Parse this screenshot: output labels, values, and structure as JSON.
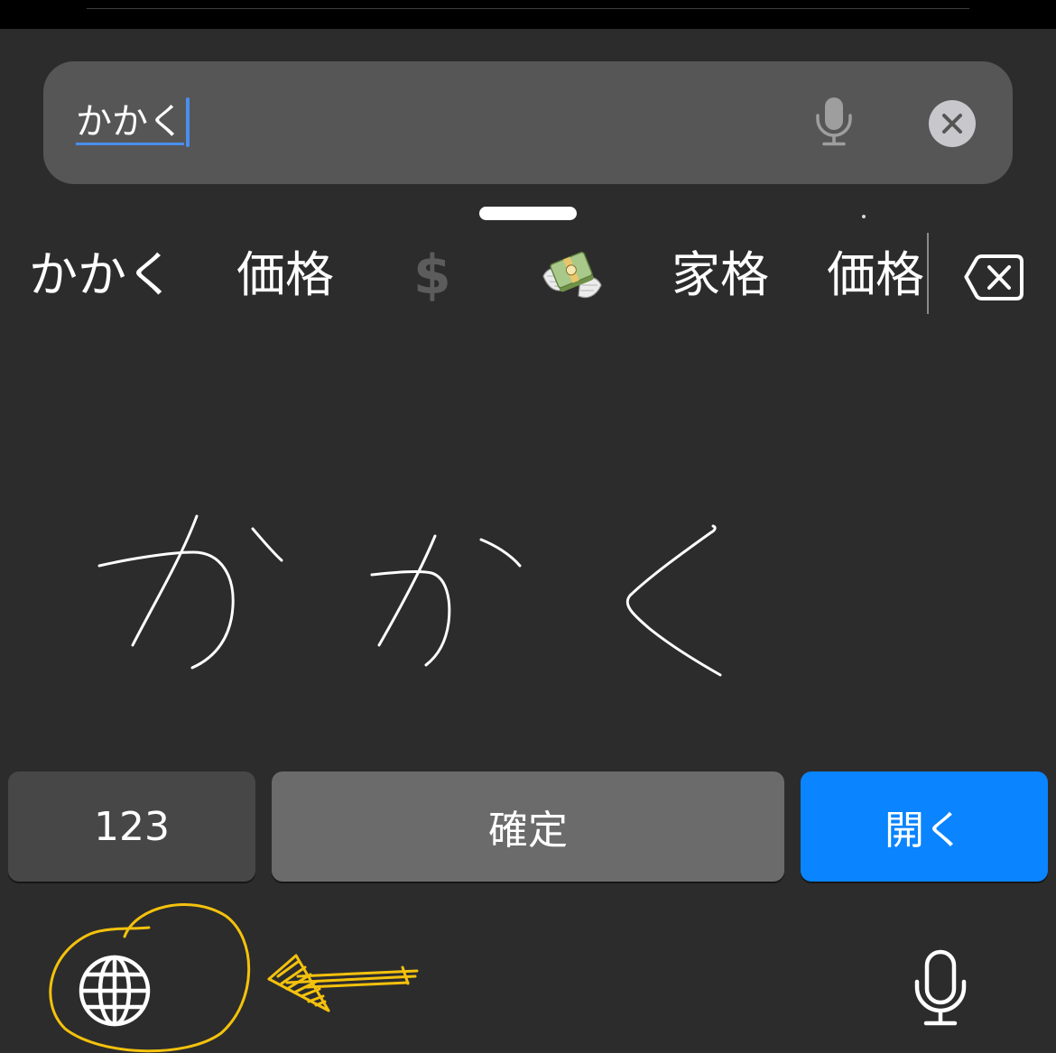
{
  "colors": {
    "background": "#2c2c2c",
    "search_field": "#565656",
    "accent": "#0a84ff",
    "cursor": "#4a8ef0",
    "annotation": "#f4c20d",
    "candidate_muted": "#5c5c5c"
  },
  "search": {
    "value": "かかく",
    "mic_icon": "microphone-icon",
    "clear_icon": "clear-icon"
  },
  "candidates": [
    {
      "text": "かかく"
    },
    {
      "text": "価格"
    },
    {
      "text": "$"
    },
    {
      "icon": "money-with-wings-icon"
    },
    {
      "text": "家格"
    },
    {
      "text": "価格"
    }
  ],
  "backspace_icon": "delete-left-icon",
  "keys": {
    "numbers": "123",
    "confirm": "確定",
    "open": "開く"
  },
  "bottom_bar": {
    "globe_icon": "globe-icon",
    "dictation_icon": "microphone-icon"
  },
  "annotations": {
    "circle": "annotation-circle",
    "arrow": "annotation-arrow"
  }
}
